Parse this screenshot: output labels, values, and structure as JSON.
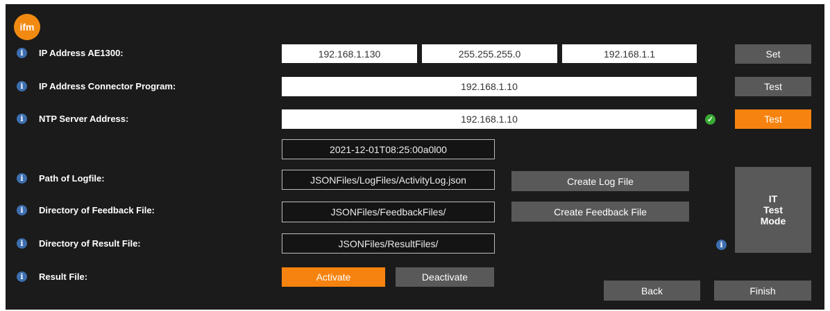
{
  "logo": {
    "text": "ifm"
  },
  "colors": {
    "accent": "#f6830f",
    "info": "#3d6fb0",
    "ok": "#39a935",
    "background": "#1b1b1b"
  },
  "rows": {
    "ip_ae1300": {
      "label": "IP Address AE1300:",
      "ip": "192.168.1.130",
      "subnet": "255.255.255.0",
      "gateway": "192.168.1.1",
      "button": "Set"
    },
    "ip_connector": {
      "label": "IP Address Connector Program:",
      "value": "192.168.1.10",
      "button": "Test"
    },
    "ntp": {
      "label": "NTP Server Address:",
      "value": "192.168.1.10",
      "status_icon": "check-icon",
      "button": "Test"
    },
    "timestamp": {
      "value": "2021-12-01T08:25:00a0l00"
    },
    "logfile": {
      "label": "Path of Logfile:",
      "value": "JSONFiles/LogFiles/ActivityLog.json",
      "button": "Create Log File"
    },
    "feedback": {
      "label": "Directory of Feedback File:",
      "value": "JSONFiles/FeedbackFiles/",
      "button": "Create Feedback File"
    },
    "result_dir": {
      "label": "Directory of Result File:",
      "value": "JSONFiles/ResultFiles/"
    },
    "result_file": {
      "label": "Result File:",
      "activate": "Activate",
      "deactivate": "Deactivate"
    }
  },
  "it_test_mode": {
    "line1": "IT",
    "line2": "Test",
    "line3": "Mode"
  },
  "footer": {
    "back": "Back",
    "finish": "Finish"
  }
}
